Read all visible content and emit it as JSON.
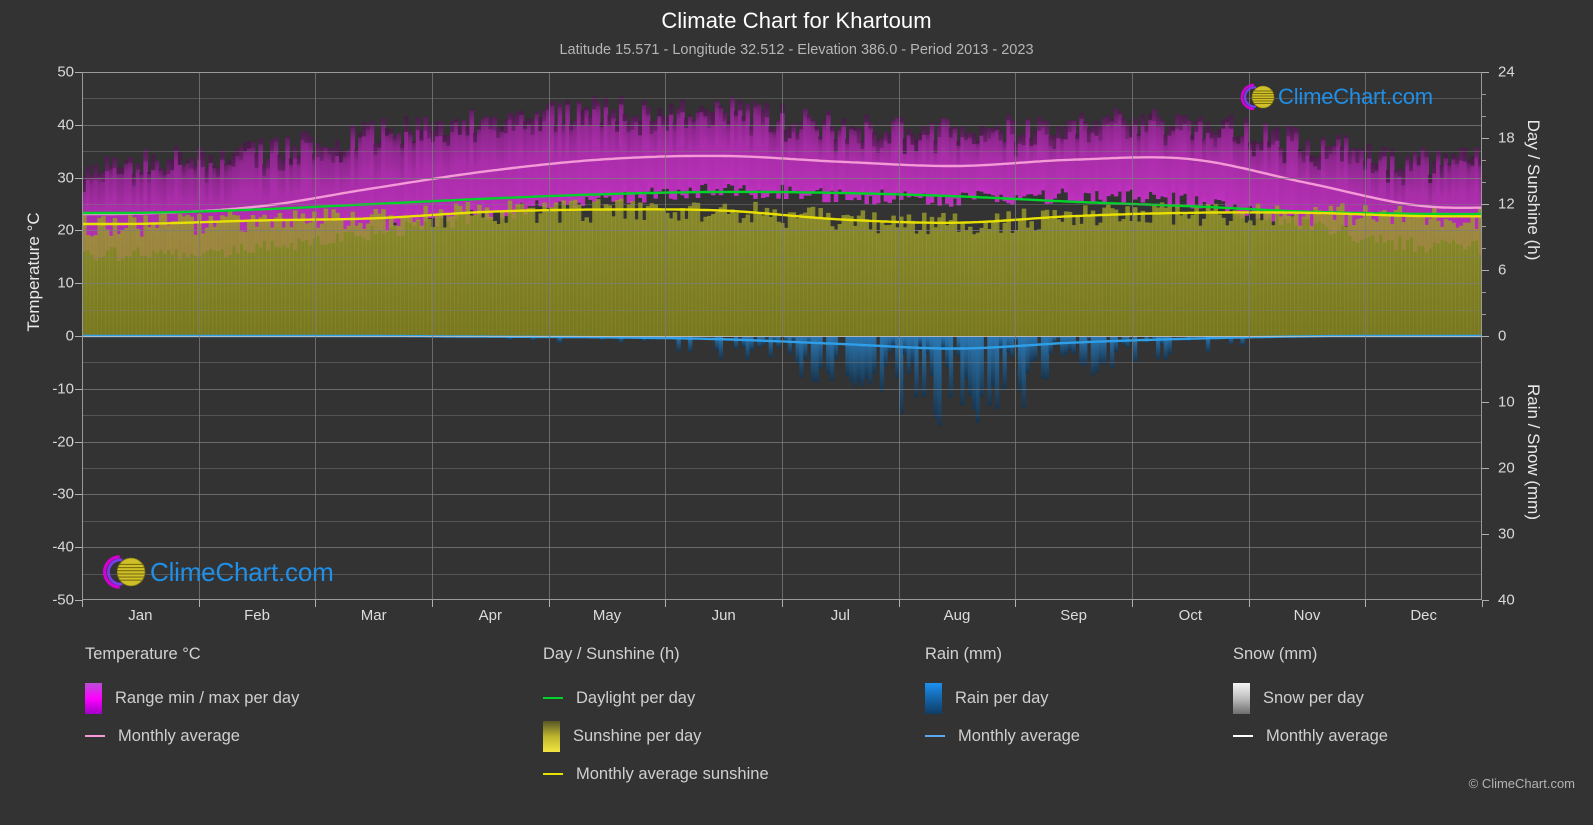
{
  "header": {
    "title": "Climate Chart for Khartoum",
    "subtitle": "Latitude 15.571 - Longitude 32.512 - Elevation 386.0 - Period 2013 - 2023"
  },
  "axes": {
    "left_label": "Temperature °C",
    "right_label_top": "Day / Sunshine (h)",
    "right_label_bottom": "Rain / Snow (mm)",
    "left_ticks": [
      "50",
      "40",
      "30",
      "20",
      "10",
      "0",
      "-10",
      "-20",
      "-30",
      "-40",
      "-50"
    ],
    "right_ticks_top": [
      "24",
      "18",
      "12",
      "6",
      "0"
    ],
    "right_ticks_bottom": [
      "10",
      "20",
      "30",
      "40"
    ],
    "x_ticks": [
      "Jan",
      "Feb",
      "Mar",
      "Apr",
      "May",
      "Jun",
      "Jul",
      "Aug",
      "Sep",
      "Oct",
      "Nov",
      "Dec"
    ]
  },
  "legend": {
    "temperature": {
      "heading": "Temperature °C",
      "items": [
        {
          "label": "Range min / max per day",
          "swatch": "gradient-magenta",
          "color": "#d400d4"
        },
        {
          "label": "Monthly average",
          "swatch": "line",
          "color": "#f49ad6"
        }
      ]
    },
    "day_sunshine": {
      "heading": "Day / Sunshine (h)",
      "items": [
        {
          "label": "Daylight per day",
          "swatch": "line",
          "color": "#00d42a"
        },
        {
          "label": "Sunshine per day",
          "swatch": "gradient-yellow",
          "color": "#f2e541"
        },
        {
          "label": "Monthly average sunshine",
          "swatch": "line",
          "color": "#e8e000"
        }
      ]
    },
    "rain": {
      "heading": "Rain (mm)",
      "items": [
        {
          "label": "Rain per day",
          "swatch": "gradient-blue",
          "color": "#1e90f0"
        },
        {
          "label": "Monthly average",
          "swatch": "line",
          "color": "#5aa9ee"
        }
      ]
    },
    "snow": {
      "heading": "Snow (mm)",
      "items": [
        {
          "label": "Snow per day",
          "swatch": "gradient-white",
          "color": "#e8e8e8"
        },
        {
          "label": "Monthly average",
          "swatch": "line",
          "color": "#ffffff"
        }
      ]
    }
  },
  "watermark": {
    "text": "ClimeChart.com",
    "copyright": "© ClimeChart.com"
  },
  "colors": {
    "background": "#333333",
    "grid": "#7d7d7d",
    "temp_range": "#a32ca3",
    "temp_avg_line": "#f49ad6",
    "daylight_line": "#00d42a",
    "sunshine_fill": "#8a8a28",
    "sunshine_line": "#e8e000",
    "rain_bar": "#1d4f7a",
    "rain_avg_line": "#2f9fe8"
  },
  "chart_data": {
    "type": "area",
    "title": "Climate Chart for Khartoum",
    "subtitle": "Latitude 15.571 - Longitude 32.512 - Elevation 386.0 - Period 2013 - 2023",
    "xlabel": "",
    "ylabel": "Temperature °C",
    "y2label_top": "Day / Sunshine (h)",
    "y2label_bottom": "Rain / Snow (mm)",
    "ylim": [
      -50,
      50
    ],
    "y2lim_top": [
      0,
      24
    ],
    "y2lim_bottom": [
      0,
      40
    ],
    "grid": true,
    "legend_position": "below",
    "categories": [
      "Jan",
      "Feb",
      "Mar",
      "Apr",
      "May",
      "Jun",
      "Jul",
      "Aug",
      "Sep",
      "Oct",
      "Nov",
      "Dec"
    ],
    "series": [
      {
        "name": "Monthly average temperature",
        "unit": "°C",
        "color": "#f49ad6",
        "values": [
          23.2,
          24.5,
          28.0,
          31.3,
          33.5,
          34.1,
          33.0,
          32.2,
          33.4,
          33.5,
          29.0,
          24.6
        ]
      },
      {
        "name": "Temperature range max per day",
        "unit": "°C",
        "color": "#d400d4",
        "values": [
          32.0,
          34.0,
          37.5,
          40.5,
          42.0,
          42.0,
          39.0,
          38.0,
          39.5,
          39.5,
          36.0,
          32.5
        ]
      },
      {
        "name": "Temperature range min per day",
        "unit": "°C",
        "color": "#d400d4",
        "values": [
          15.5,
          16.5,
          19.5,
          23.0,
          26.0,
          27.5,
          26.5,
          26.0,
          26.5,
          25.5,
          21.0,
          17.0
        ]
      },
      {
        "name": "Daylight per day",
        "unit": "h",
        "color": "#00d42a",
        "values": [
          11.2,
          11.5,
          12.0,
          12.5,
          12.9,
          13.1,
          13.0,
          12.7,
          12.2,
          11.8,
          11.3,
          11.1
        ]
      },
      {
        "name": "Monthly average sunshine",
        "unit": "h",
        "color": "#e8e000",
        "values": [
          10.2,
          10.5,
          10.7,
          11.3,
          11.5,
          11.4,
          10.6,
          10.3,
          10.9,
          11.2,
          11.2,
          10.9
        ]
      },
      {
        "name": "Monthly average rain",
        "unit": "mm",
        "color": "#2f9fe8",
        "values": [
          0.0,
          0.0,
          0.0,
          0.1,
          0.2,
          0.5,
          1.2,
          1.9,
          1.0,
          0.4,
          0.05,
          0.0
        ]
      },
      {
        "name": "Monthly average snow",
        "unit": "mm",
        "color": "#ffffff",
        "values": [
          0.0,
          0.0,
          0.0,
          0.0,
          0.0,
          0.0,
          0.0,
          0.0,
          0.0,
          0.0,
          0.0,
          0.0
        ]
      }
    ]
  }
}
